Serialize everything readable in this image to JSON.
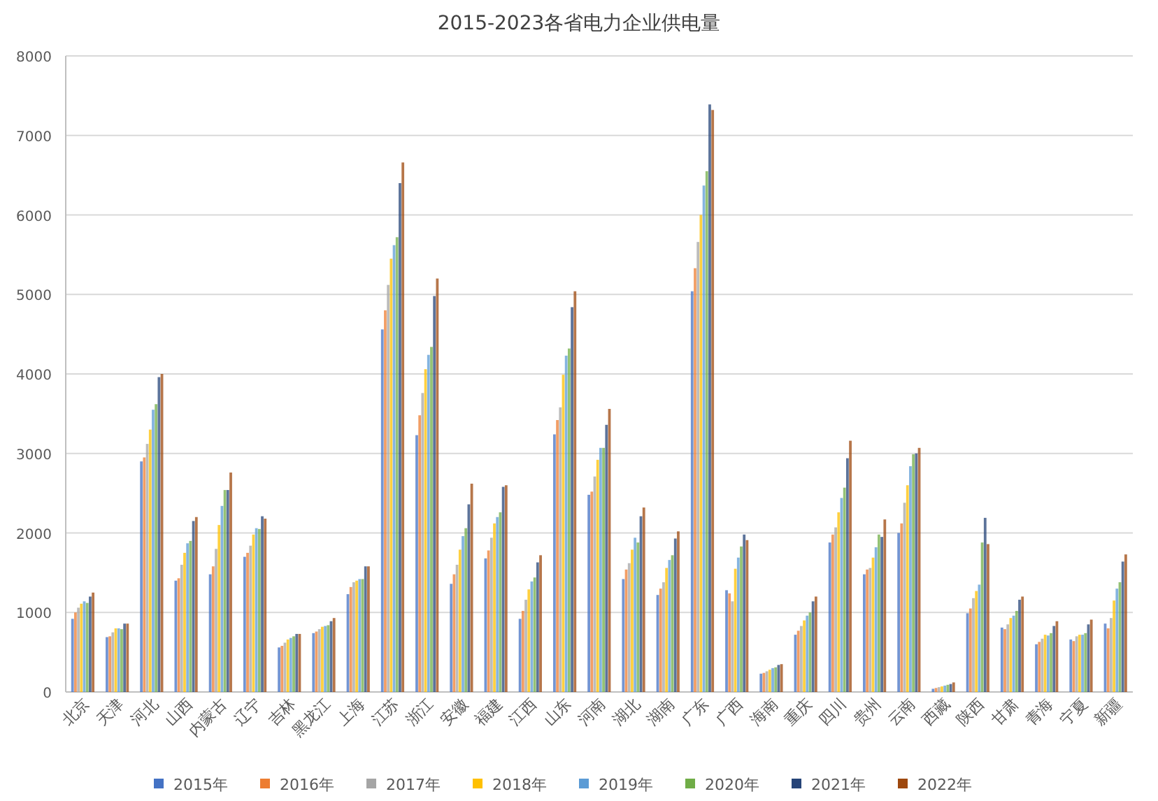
{
  "chart_data": {
    "type": "bar",
    "title": "2015-2023各省电力企业供电量",
    "categories": [
      "北京",
      "天津",
      "河北",
      "山西",
      "内蒙古",
      "辽宁",
      "吉林",
      "黑龙江",
      "上海",
      "江苏",
      "浙江",
      "安徽",
      "福建",
      "江西",
      "山东",
      "河南",
      "湖北",
      "湖南",
      "广东",
      "广西",
      "海南",
      "重庆",
      "四川",
      "贵州",
      "云南",
      "西藏",
      "陕西",
      "甘肃",
      "青海",
      "宁夏",
      "新疆"
    ],
    "grid": true,
    "legend": true,
    "ylim": [
      0,
      8000
    ],
    "yticks": [
      0,
      1000,
      2000,
      3000,
      4000,
      5000,
      6000,
      7000,
      8000
    ],
    "series": [
      {
        "name": "2015年",
        "color": "#4472c4",
        "values": [
          920,
          690,
          2900,
          1400,
          1480,
          1700,
          560,
          740,
          1230,
          4560,
          3230,
          1360,
          1680,
          920,
          3240,
          2480,
          1420,
          1220,
          5040,
          1280,
          230,
          720,
          1880,
          1480,
          2000,
          40,
          990,
          810,
          600,
          660,
          860
        ]
      },
      {
        "name": "2016年",
        "color": "#ed7d31",
        "values": [
          1000,
          700,
          2950,
          1430,
          1580,
          1750,
          580,
          760,
          1320,
          4800,
          3480,
          1480,
          1780,
          1020,
          3420,
          2520,
          1540,
          1300,
          5330,
          1240,
          240,
          770,
          1980,
          1540,
          2120,
          50,
          1050,
          790,
          630,
          640,
          800
        ]
      },
      {
        "name": "2017年",
        "color": "#a5a5a5",
        "values": [
          1060,
          750,
          3120,
          1600,
          1800,
          1840,
          620,
          790,
          1380,
          5120,
          3760,
          1600,
          1940,
          1160,
          3580,
          2710,
          1620,
          1380,
          5660,
          1140,
          260,
          830,
          2070,
          1560,
          2380,
          60,
          1180,
          850,
          670,
          700,
          930
        ]
      },
      {
        "name": "2018年",
        "color": "#ffc000",
        "values": [
          1110,
          800,
          3300,
          1750,
          2100,
          1980,
          660,
          820,
          1400,
          5450,
          4060,
          1790,
          2120,
          1290,
          3990,
          2920,
          1790,
          1560,
          6000,
          1550,
          280,
          900,
          2260,
          1690,
          2600,
          70,
          1270,
          930,
          720,
          720,
          1150
        ]
      },
      {
        "name": "2019年",
        "color": "#5b9bd5",
        "values": [
          1140,
          800,
          3550,
          1870,
          2340,
          2060,
          680,
          830,
          1420,
          5620,
          4240,
          1960,
          2200,
          1390,
          4230,
          3070,
          1940,
          1660,
          6370,
          1690,
          300,
          960,
          2440,
          1820,
          2840,
          80,
          1350,
          960,
          710,
          720,
          1300
        ]
      },
      {
        "name": "2020年",
        "color": "#70ad47",
        "values": [
          1120,
          790,
          3620,
          1900,
          2540,
          2050,
          700,
          840,
          1420,
          5720,
          4340,
          2060,
          2260,
          1440,
          4320,
          3070,
          1880,
          1720,
          6550,
          1830,
          310,
          1000,
          2570,
          1980,
          2990,
          90,
          1880,
          1020,
          740,
          740,
          1380
        ]
      },
      {
        "name": "2021年",
        "color": "#264478",
        "values": [
          1200,
          860,
          3960,
          2150,
          2540,
          2210,
          730,
          890,
          1580,
          6400,
          4980,
          2360,
          2580,
          1630,
          4840,
          3360,
          2210,
          1930,
          7390,
          1980,
          340,
          1140,
          2940,
          1950,
          3000,
          100,
          2190,
          1160,
          830,
          850,
          1640
        ]
      },
      {
        "name": "2022年",
        "color": "#9e480e",
        "values": [
          1250,
          860,
          4000,
          2200,
          2760,
          2180,
          730,
          930,
          1580,
          6660,
          5200,
          2620,
          2600,
          1720,
          5040,
          3560,
          2320,
          2020,
          7320,
          1910,
          350,
          1200,
          3160,
          2170,
          3070,
          120,
          1860,
          1200,
          890,
          910,
          1730
        ]
      }
    ]
  }
}
